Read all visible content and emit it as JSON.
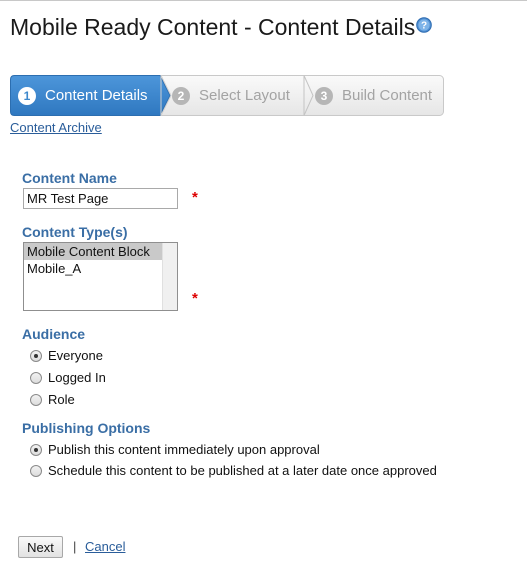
{
  "header": {
    "title": "Mobile Ready Content - Content Details",
    "help_icon": "question-circle-icon",
    "accent_color": "#3d88cc"
  },
  "wizard": {
    "steps": [
      {
        "number": "1",
        "label": "Content Details",
        "active": true
      },
      {
        "number": "2",
        "label": "Select Layout",
        "active": false
      },
      {
        "number": "3",
        "label": "Build Content",
        "active": false
      }
    ]
  },
  "links": {
    "content_archive": "Content Archive"
  },
  "form": {
    "content_name": {
      "label": "Content Name",
      "value": "MR Test Page",
      "required_mark": "*"
    },
    "content_types": {
      "label": "Content Type(s)",
      "options": [
        "Mobile Content Block",
        "Mobile_A"
      ],
      "selected": "Mobile Content Block",
      "required_mark": "*"
    },
    "audience": {
      "label": "Audience",
      "options": [
        "Everyone",
        "Logged In",
        "Role"
      ],
      "selected": "Everyone"
    },
    "publishing": {
      "label": "Publishing Options",
      "options": [
        "Publish this content immediately upon approval",
        "Schedule this content to be published at a later date once approved"
      ],
      "selected": "Publish this content immediately upon approval"
    }
  },
  "actions": {
    "next_label": "Next",
    "separator": "|",
    "cancel_label": "Cancel"
  }
}
